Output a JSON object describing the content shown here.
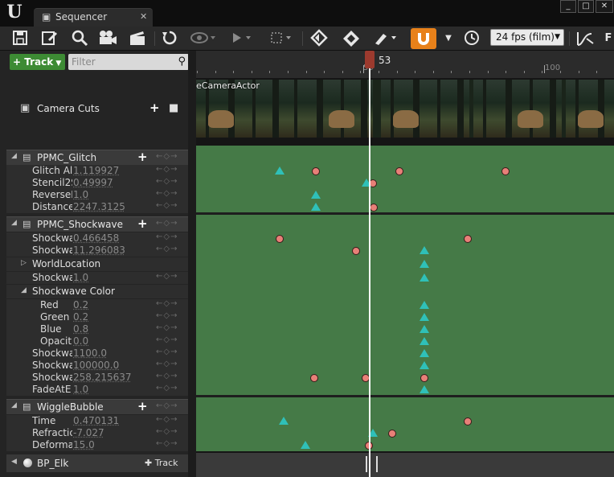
{
  "window": {
    "tab_title": "Sequencer",
    "tab_close": "✕",
    "win_buttons": [
      "_",
      "□",
      "✕"
    ]
  },
  "toolbar": {
    "icons": [
      "save-icon",
      "edit-icon",
      "search-icon",
      "camera-icon",
      "clapper-icon",
      "undo-icon",
      "eye-icon",
      "play-icon",
      "select-icon",
      "key-icon",
      "transform-icon",
      "curve-icon",
      "magnet-icon",
      "clock-icon"
    ],
    "fps": "24 fps (film)",
    "overflow_label": "F"
  },
  "left": {
    "track_button": "Track",
    "filter_placeholder": "Filter",
    "camera_cuts": "Camera Cuts",
    "sections": [
      {
        "label": "PPMC_Glitch",
        "rows": [
          {
            "name": "Glitch Al",
            "value": "1.119927"
          },
          {
            "name": "Stencil2S",
            "value": "0.49997"
          },
          {
            "name": "ReverseD",
            "value": "1.0"
          },
          {
            "name": "Distance",
            "value": "2247.3125"
          }
        ]
      },
      {
        "label": "PPMC_Shockwave",
        "rows": [
          {
            "name": "Shockwa",
            "value": "0.466458"
          },
          {
            "name": "Shockwa",
            "value": "11.296083"
          },
          {
            "name": "WorldLocation",
            "value": "",
            "group": true
          },
          {
            "name": "Shockwa",
            "value": "1.0"
          },
          {
            "name": "Shockwave Color",
            "value": "",
            "group": true,
            "open": true
          },
          {
            "name": "Red",
            "value": "0.2",
            "indent": true
          },
          {
            "name": "Green",
            "value": "0.2",
            "indent": true
          },
          {
            "name": "Blue",
            "value": "0.8",
            "indent": true
          },
          {
            "name": "Opacit",
            "value": "0.0",
            "indent": true
          },
          {
            "name": "Shockwa",
            "value": "1100.0"
          },
          {
            "name": "Shockwa",
            "value": "100000.0"
          },
          {
            "name": "Shockwa",
            "value": "258.215637"
          },
          {
            "name": "FadeAtE",
            "value": "1.0"
          }
        ]
      },
      {
        "label": "WiggleBubble",
        "rows": [
          {
            "name": "Time",
            "value": "0.470131"
          },
          {
            "name": "Refractic",
            "value": "-7.027"
          },
          {
            "name": "Deforma",
            "value": "15.0"
          }
        ]
      }
    ],
    "actor": "BP_Elk",
    "actor_track": "Track"
  },
  "timeline": {
    "current_frame": "53",
    "tick_labels": [
      "50",
      "100"
    ],
    "camera_actor_label": "eCameraActor"
  }
}
